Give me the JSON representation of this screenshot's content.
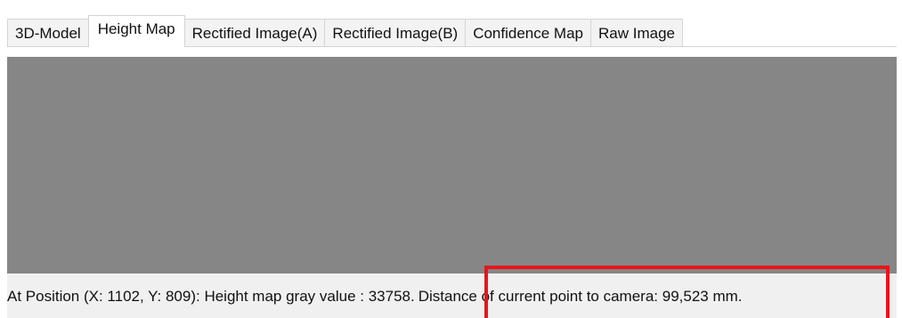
{
  "tabs": [
    {
      "label": "3D-Model",
      "active": false
    },
    {
      "label": "Height Map",
      "active": true
    },
    {
      "label": "Rectified Image(A)",
      "active": false
    },
    {
      "label": "Rectified Image(B)",
      "active": false
    },
    {
      "label": "Confidence Map",
      "active": false
    },
    {
      "label": "Raw Image",
      "active": false
    }
  ],
  "status": {
    "position_info": "At Position  (X: 1102, Y: 809): Height map gray value : 33758.",
    "distance_info": "Distance of current point to camera: 99,523 mm."
  },
  "colors": {
    "viewport_gray": "#868686",
    "highlight_red": "#e8151b"
  }
}
